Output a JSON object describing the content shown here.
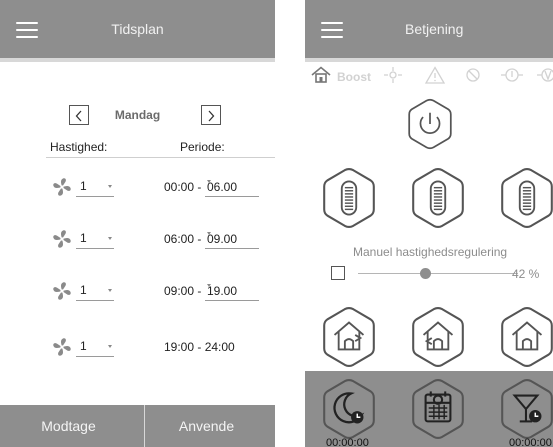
{
  "schedule": {
    "title": "Tidsplan",
    "day": "Mandag",
    "speed_header": "Hastighed:",
    "period_header": "Periode:",
    "rows": [
      {
        "speed": "1",
        "period_start": "00:00 - ",
        "period_end": "06.00"
      },
      {
        "speed": "1",
        "period_start": "06:00 - ",
        "period_end": "09.00"
      },
      {
        "speed": "1",
        "period_start": "09:00 - ",
        "period_end": "19.00"
      },
      {
        "speed": "1",
        "period_start": "19:00 - 24:00",
        "period_end": ""
      }
    ],
    "buttons": {
      "receive": "Modtage",
      "apply": "Anvende"
    },
    "colors": {
      "bar": "#8e8e8e",
      "fan": "#8a8a8a"
    }
  },
  "control": {
    "title": "Betjening",
    "status": {
      "boost_label": "Boost"
    },
    "manual_speed_label": "Manuel hastighedsregulering",
    "speed_percent": 42,
    "speed_percent_label": "42 %",
    "timers": [
      "00:00:00",
      "00:00:00"
    ],
    "icons": [
      "home-icon",
      "fan-status-icon",
      "warning-icon",
      "filter-icon",
      "power-icon",
      "speed-bars-icon",
      "moon-clock-icon",
      "calendar-clock-icon",
      "party-clock-icon"
    ]
  }
}
